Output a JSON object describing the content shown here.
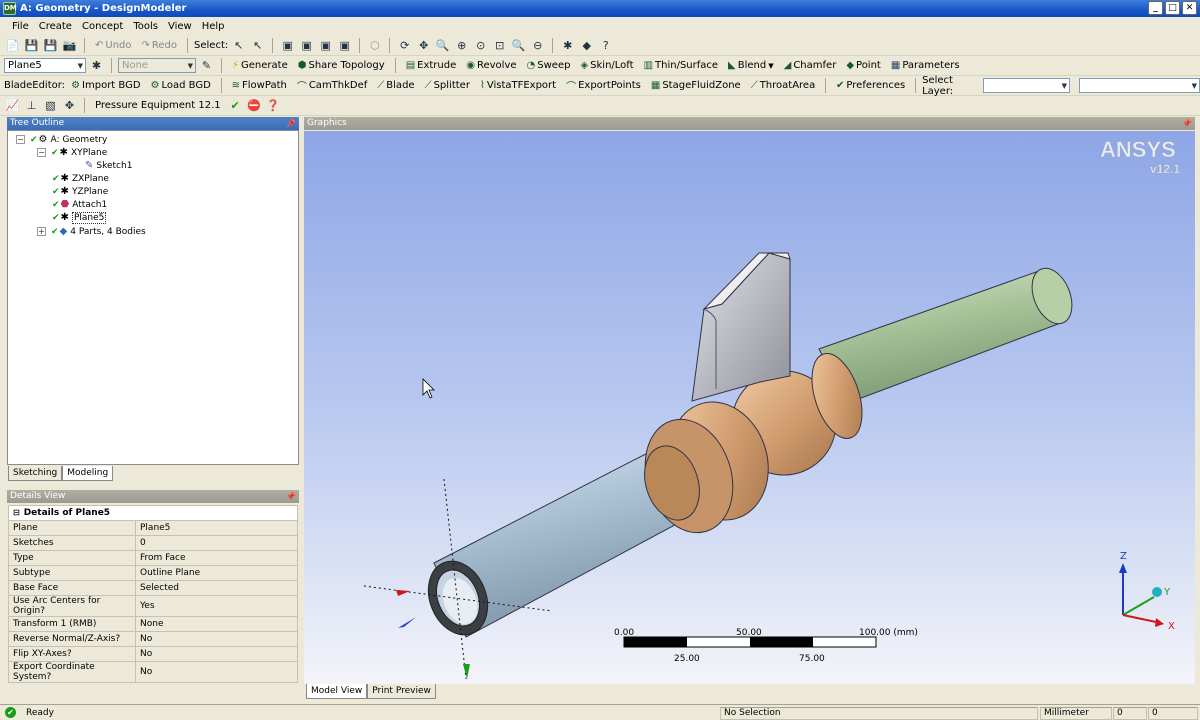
{
  "window": {
    "title": "A: Geometry - DesignModeler",
    "app_icon": "DM"
  },
  "menu": [
    "File",
    "Create",
    "Concept",
    "Tools",
    "View",
    "Help"
  ],
  "toolbar1": {
    "undo": "Undo",
    "redo": "Redo",
    "select_label": "Select:"
  },
  "toolbar2": {
    "plane_combo": "Plane5",
    "sketch_combo": "None",
    "buttons": [
      "Generate",
      "Share Topology",
      "Extrude",
      "Revolve",
      "Sweep",
      "Skin/Loft",
      "Thin/Surface",
      "Blend",
      "Chamfer",
      "Point",
      "Parameters"
    ]
  },
  "toolbar3": {
    "label": "BladeEditor:",
    "buttons": [
      "Import BGD",
      "Load BGD",
      "FlowPath",
      "CamThkDef",
      "Blade",
      "Splitter",
      "VistaTFExport",
      "ExportPoints",
      "StageFluidZone",
      "ThroatArea",
      "Preferences"
    ],
    "select_layer": "Select Layer:"
  },
  "toolbar4": {
    "label": "Pressure Equipment 12.1"
  },
  "tree": {
    "title": "Tree Outline",
    "items": [
      {
        "label": "A: Geometry",
        "icon": "geometry-icon"
      },
      {
        "label": "XYPlane",
        "icon": "plane-icon"
      },
      {
        "label": "Sketch1",
        "icon": "sketch-icon"
      },
      {
        "label": "ZXPlane",
        "icon": "plane-icon"
      },
      {
        "label": "YZPlane",
        "icon": "plane-icon"
      },
      {
        "label": "Attach1",
        "icon": "attach-icon"
      },
      {
        "label": "Plane5",
        "icon": "plane-icon"
      },
      {
        "label": "4 Parts, 4 Bodies",
        "icon": "bodies-icon"
      }
    ]
  },
  "mode_tabs": [
    "Sketching",
    "Modeling"
  ],
  "details": {
    "title": "Details View",
    "header": "Details of Plane5",
    "rows": [
      {
        "k": "Plane",
        "v": "Plane5"
      },
      {
        "k": "Sketches",
        "v": "0"
      },
      {
        "k": "Type",
        "v": "From Face"
      },
      {
        "k": "Subtype",
        "v": "Outline Plane"
      },
      {
        "k": "Base Face",
        "v": "Selected"
      },
      {
        "k": "Use Arc Centers for Origin?",
        "v": "Yes"
      },
      {
        "k": "Transform 1 (RMB)",
        "v": "None"
      },
      {
        "k": "Reverse Normal/Z-Axis?",
        "v": "No"
      },
      {
        "k": "Flip XY-Axes?",
        "v": "No"
      },
      {
        "k": "Export Coordinate System?",
        "v": "No"
      }
    ]
  },
  "graphics": {
    "title": "Graphics",
    "logo": "ANSYS",
    "version": "v12.1",
    "scale": {
      "top": [
        "0.00",
        "50.00",
        "100.00 (mm)"
      ],
      "bottom": [
        "25.00",
        "75.00"
      ]
    },
    "triad": {
      "z": "Z",
      "y": "Y",
      "x": "X"
    }
  },
  "view_tabs": [
    "Model View",
    "Print Preview"
  ],
  "status": {
    "ready": "Ready",
    "selection": "No Selection",
    "units": "Millimeter",
    "v1": "0",
    "v2": "0"
  }
}
